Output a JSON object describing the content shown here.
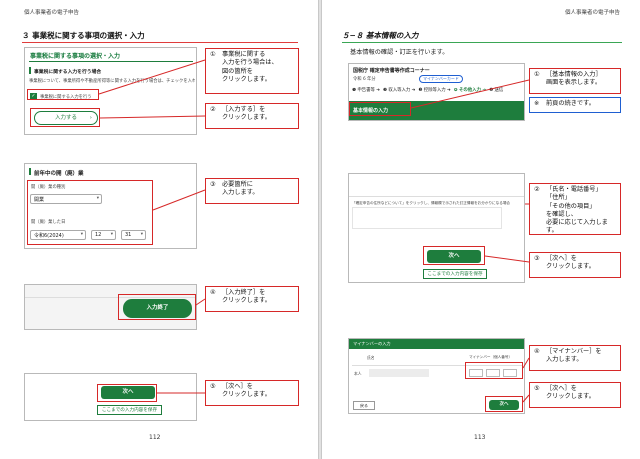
{
  "header": {
    "running_left": "個人事業者の電子申告",
    "running_right": "個人事業者の電子申告"
  },
  "left_page": {
    "section_title": "３ 事業税に関する事項の選択・入力",
    "page_number": "112",
    "panel1": {
      "title": "事業税に関する事項の選択・入力",
      "subtitle": "事業税に関する入力を行う場合",
      "desc": "事業税について、事業所得や不動産所得等に関する入力を行う場合は、チェックを入れてください。",
      "checkbox_label": "事業税に関する入力を行う",
      "input_button": "入力する"
    },
    "panel2": {
      "title": "前年中の開（廃）業",
      "field1_label": "開（廃）業の種別",
      "field1_value": "開業",
      "field2_label": "開（廃）業した日",
      "era_value": "令和6(2024)",
      "month_value": "12",
      "day_value": "31"
    },
    "panel3": {
      "button": "入力終了"
    },
    "panel4": {
      "next_button": "次へ",
      "save_button": "ここまでの入力内容を保存"
    },
    "callouts": [
      {
        "num": "①",
        "lines": [
          "事業税に関する",
          "入力を行う場合は、",
          "図の箇所を",
          "クリックします。"
        ]
      },
      {
        "num": "②",
        "lines": [
          "［入力する］を",
          "クリックします。"
        ]
      },
      {
        "num": "③",
        "lines": [
          "必要箇所に",
          "入力します。"
        ]
      },
      {
        "num": "④",
        "lines": [
          "［入力終了］を",
          "クリックします。"
        ]
      },
      {
        "num": "⑤",
        "lines": [
          "［次へ］を",
          "クリックします。"
        ]
      }
    ]
  },
  "right_page": {
    "section_title": "５−８ 基本情報の入力",
    "intro": "基本情報の確認・訂正を行います。",
    "page_number": "113",
    "panel1": {
      "agency": "国税庁 確定申告書等作成コーナー",
      "meta": "令和 6 年分",
      "mynumber_chip": "マイナンバーカード",
      "steps": [
        "❶ 申告書等 ➔",
        "❷ 収入等入力 ➔",
        "❸ 控除等入力 ➔",
        "❹ その他入力 ➔",
        "❺ 送信"
      ],
      "bar_title": "基本情報の入力"
    },
    "panel2": {
      "note": "「確定申告の住所などについて」をクリックし、情報欄で示された訂正情報をお分かりになる場合",
      "next_button": "次へ",
      "save_button": "ここまでの入力内容を保存"
    },
    "panel3": {
      "title": "マイナンバーの入力",
      "col1": "氏名",
      "col2": "マイナンバー（個人番号）",
      "row_label": "本人",
      "back_button": "戻る",
      "next_button": "次へ"
    },
    "callouts": [
      {
        "num": "①",
        "lines": [
          "［基本情報の入力］",
          "画面を表示します。"
        ]
      },
      {
        "num": "※",
        "lines": [
          "前頁の続きです。"
        ]
      },
      {
        "num": "②",
        "lines": [
          "「氏名・電話番号」",
          "「住所」",
          "「その他の項目」",
          "を確認し、",
          "必要に応じて入力します。"
        ]
      },
      {
        "num": "③",
        "lines": [
          "［次へ］を",
          "クリックします。"
        ]
      },
      {
        "num": "④",
        "lines": [
          "［マイナンバー］を",
          "入力します。"
        ]
      },
      {
        "num": "⑤",
        "lines": [
          "［次へ］を",
          "クリックします。"
        ]
      }
    ]
  },
  "colors": {
    "accent_red": "#d62828",
    "green": "#1e7d3d",
    "blue": "#1f5fd1"
  }
}
